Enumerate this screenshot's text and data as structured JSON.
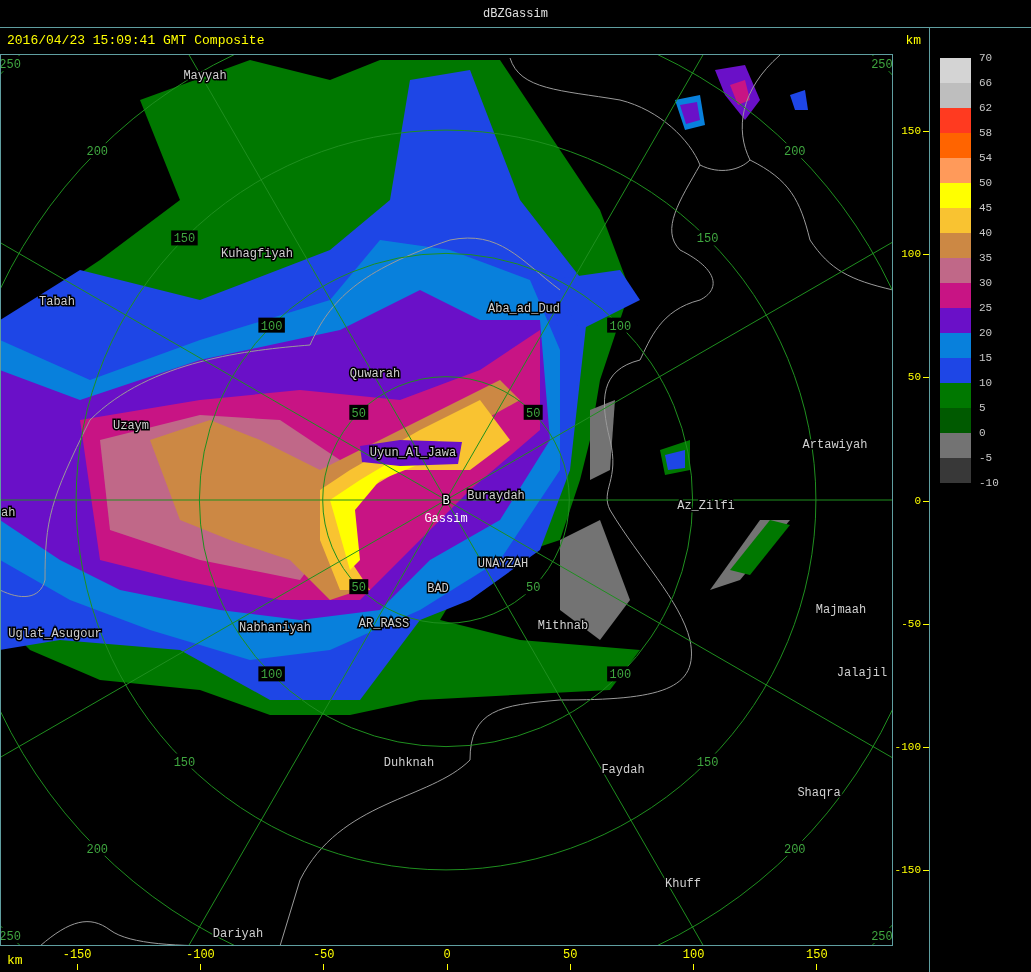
{
  "window": {
    "title": "dBZGassim"
  },
  "header": {
    "timestamp": "2016/04/23 15:09:41 GMT Composite",
    "unit": "km"
  },
  "map": {
    "center_marker": "B",
    "radar_name": "Gassim",
    "places": [
      "Mayyah",
      "Kuhagfiyah",
      "Tabah",
      "Aba_ad_Dud",
      "Quwarah",
      "Uzaym",
      "Uyun_Al_Jawa",
      "Artawiyah",
      "Buraydah",
      "Az_Zilfi",
      "ah",
      "UNAYZAH",
      "BAD",
      "Majmaah",
      "Uglat_Asugour",
      "Nabhaniyah",
      "AR_RASS",
      "Mithnab",
      "Jalajil",
      "Duhknah",
      "Faydah",
      "Shaqra",
      "Khuff",
      "Dariyah"
    ],
    "range_ring_labels": [
      "50",
      "50",
      "50",
      "50",
      "100",
      "100",
      "100",
      "100",
      "150",
      "150",
      "150",
      "150",
      "200",
      "200",
      "200",
      "200",
      "250",
      "250",
      "250",
      "250"
    ]
  },
  "y_axis": {
    "ticks": [
      "150",
      "100",
      "50",
      "0",
      "-50",
      "-100",
      "-150"
    ]
  },
  "x_axis": {
    "unit": "km",
    "ticks": [
      "-150",
      "-100",
      "-50",
      "0",
      "50",
      "100",
      "150"
    ]
  },
  "legend": {
    "swatches": [
      {
        "color": "#d4d4d4"
      },
      {
        "color": "#bebebe"
      },
      {
        "color": "#ff3a20"
      },
      {
        "color": "#ff6400"
      },
      {
        "color": "#ff9a5a"
      },
      {
        "color": "#ffff00"
      },
      {
        "color": "#f9c331"
      },
      {
        "color": "#cc8844"
      },
      {
        "color": "#c06888"
      },
      {
        "color": "#c81484"
      },
      {
        "color": "#6a10c8"
      },
      {
        "color": "#0880dc"
      },
      {
        "color": "#1e46e6"
      },
      {
        "color": "#007800"
      },
      {
        "color": "#005a00"
      },
      {
        "color": "#737373"
      },
      {
        "color": "#383838"
      }
    ],
    "labels": [
      "70",
      "66",
      "62",
      "58",
      "54",
      "50",
      "45",
      "40",
      "35",
      "30",
      "25",
      "20",
      "15",
      "10",
      "5",
      "0",
      "-5",
      "-10"
    ]
  }
}
